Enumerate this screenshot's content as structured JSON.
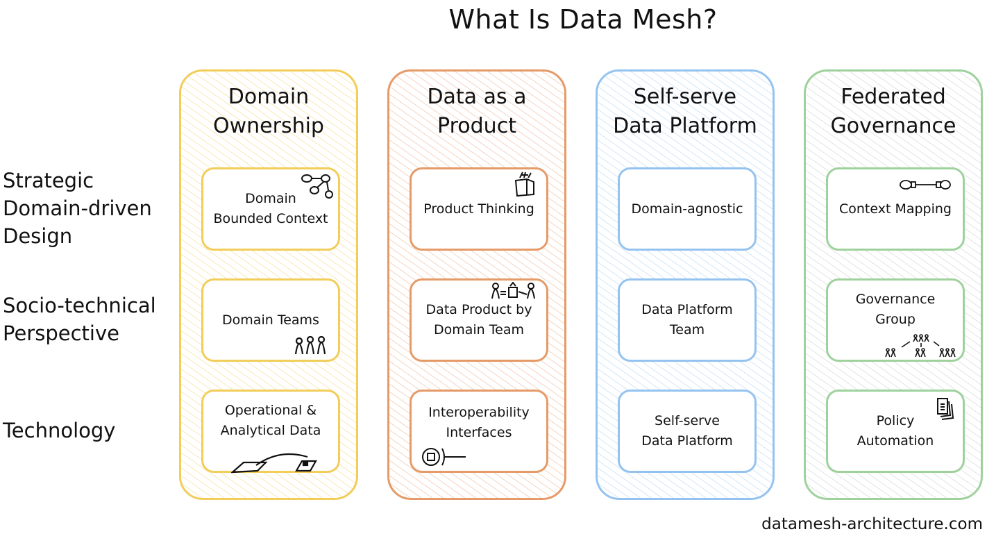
{
  "title": "What Is Data Mesh?",
  "row_labels": [
    "Strategic\nDomain-driven\nDesign",
    "Socio-technical\nPerspective",
    "Technology"
  ],
  "pillars": [
    {
      "title": "Domain\nOwnership",
      "color": "#f2cd5a",
      "cards": [
        {
          "label": "Domain\nBounded Context",
          "icon": "graph-nodes-icon"
        },
        {
          "label": "Domain Teams",
          "icon": "team-people-icon"
        },
        {
          "label": "Operational &\nAnalytical Data",
          "icon": "data-planes-icon"
        }
      ]
    },
    {
      "title": "Data as a\nProduct",
      "color": "#e59a67",
      "cards": [
        {
          "label": "Product Thinking",
          "icon": "product-box-icon"
        },
        {
          "label": "Data Product by\nDomain Team",
          "icon": "team-product-icon"
        },
        {
          "label": "Interoperability\nInterfaces",
          "icon": "interface-port-icon"
        }
      ]
    },
    {
      "title": "Self-serve\nData Platform",
      "color": "#95c3f0",
      "cards": [
        {
          "label": "Domain-agnostic"
        },
        {
          "label": "Data Platform\nTeam"
        },
        {
          "label": "Self-serve\nData Platform"
        }
      ]
    },
    {
      "title": "Federated\nGovernance",
      "color": "#9fd19d",
      "cards": [
        {
          "label": "Context Mapping",
          "icon": "context-link-icon"
        },
        {
          "label": "Governance\nGroup",
          "icon": "org-hierarchy-icon"
        },
        {
          "label": "Policy\nAutomation",
          "icon": "documents-icon"
        }
      ]
    }
  ],
  "footer": "datamesh-architecture.com"
}
